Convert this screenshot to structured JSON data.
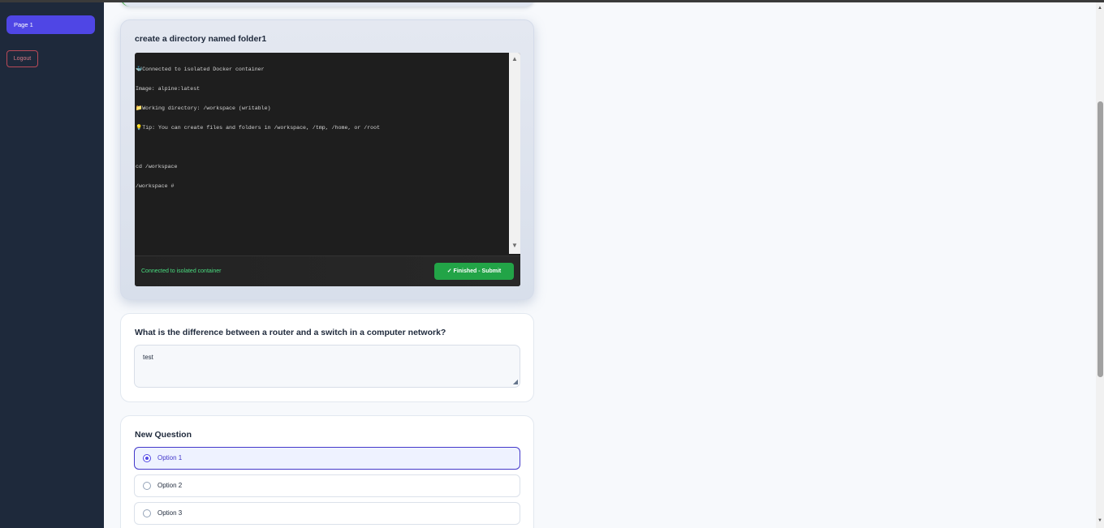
{
  "sidebar": {
    "items": [
      {
        "label": "Page 1"
      }
    ],
    "logout_label": "Logout"
  },
  "questions": [
    {
      "title": "create a directory named folder1",
      "terminal": {
        "lines": [
          "🐳Connected to isolated Docker container",
          "Image: alpine:latest",
          "📁Working directory: /workspace (writable)",
          "💡Tip: You can create files and folders in /workspace, /tmp, /home, or /root",
          "",
          "cd /workspace",
          "/workspace # "
        ],
        "status": "Connected to isolated container",
        "submit_label": "✓ Finished - Submit"
      }
    },
    {
      "title": "What is the difference between a router and a switch in a computer network?",
      "answer": "test"
    },
    {
      "title": "New Question",
      "options": [
        "Option 1",
        "Option 2",
        "Option 3"
      ],
      "selected_index": 0
    }
  ],
  "icons": {
    "scroll_up": "▲",
    "scroll_down": "▼",
    "resize": "◢"
  },
  "colors": {
    "sidebar_bg": "#1e293b",
    "accent": "#4f46e5",
    "submit": "#22a447",
    "status_text": "#4ade80",
    "logout": "#b94a58"
  }
}
